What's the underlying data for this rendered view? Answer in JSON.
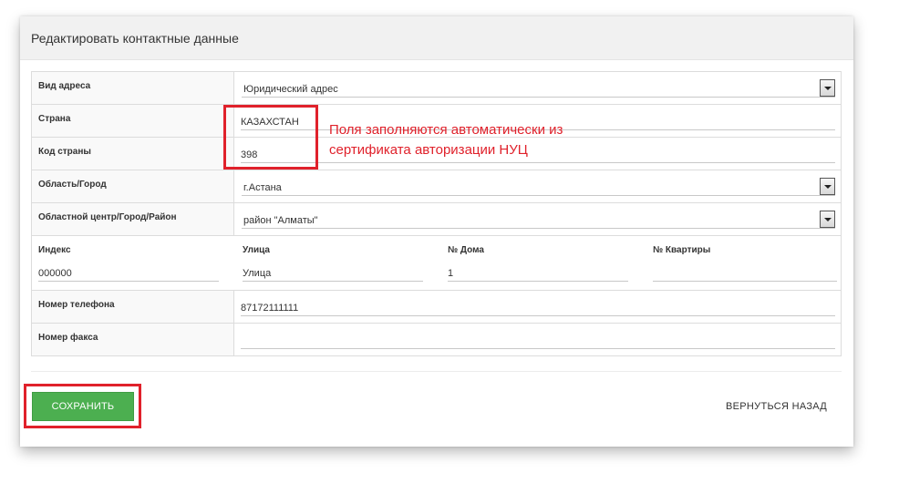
{
  "panel": {
    "title": "Редактировать контактные данные"
  },
  "form": {
    "address_type": {
      "label": "Вид адреса",
      "value": "Юридический адрес"
    },
    "country": {
      "label": "Страна",
      "value": "КАЗАХСТАН"
    },
    "country_code": {
      "label": "Код страны",
      "value": "398"
    },
    "region": {
      "label": "Область/Город",
      "value": "г.Астана"
    },
    "district": {
      "label": "Областной центр/Город/Район",
      "value": "район \"Алматы\""
    },
    "index": {
      "label": "Индекс",
      "value": "000000"
    },
    "street": {
      "label": "Улица",
      "value": "Улица"
    },
    "house": {
      "label": "№ Дома",
      "value": "1"
    },
    "apartment": {
      "label": "№ Квартиры",
      "value": ""
    },
    "phone": {
      "label": "Номер телефона",
      "value": "87172111111"
    },
    "fax": {
      "label": "Номер факса",
      "value": ""
    }
  },
  "annotation": {
    "line1": "Поля заполняются автоматически из",
    "line2": "сертификата авторизации НУЦ",
    "color": "#e0212b"
  },
  "actions": {
    "save_label": "СОХРАНИТЬ",
    "back_label": "ВЕРНУТЬСЯ НАЗАД"
  },
  "colors": {
    "accent": "#4caf50",
    "highlight": "#e0212b"
  },
  "icons": {
    "dropdown": "chevron-down-icon"
  }
}
